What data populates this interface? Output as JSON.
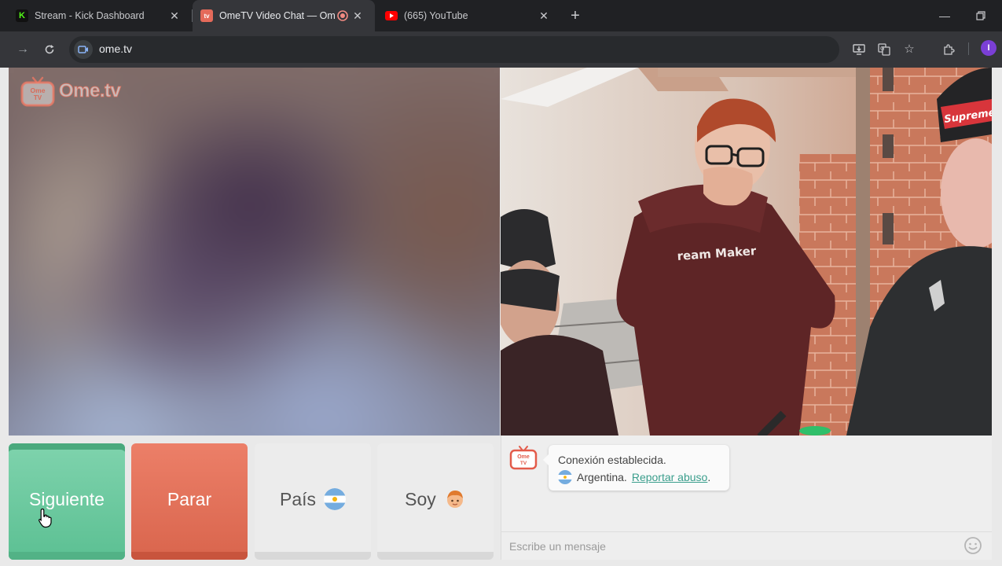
{
  "browser": {
    "tabs": [
      {
        "title": "Stream - Kick Dashboard",
        "favicon": "kick-logo-icon",
        "active": false
      },
      {
        "title": "OmeTV Video Chat — Ome",
        "favicon": "ometv-logo-icon",
        "active": true,
        "recording": true
      },
      {
        "title": "(665) YouTube",
        "favicon": "youtube-logo-icon",
        "active": false
      }
    ],
    "address": "ome.tv",
    "profile_initial": "I"
  },
  "app": {
    "logo_text": "Ome.tv",
    "logo_badge": "Ome TV",
    "buttons": {
      "next": "Siguiente",
      "stop": "Parar",
      "country": "País",
      "gender": "Soy"
    },
    "chat": {
      "status": "Conexión establecida.",
      "country": "Argentina.",
      "report": "Reportar abuso",
      "report_suffix": ".",
      "input_placeholder": "Escribe un mensaje"
    }
  },
  "colors": {
    "next": "#5cc093",
    "stop": "#d9654d",
    "link": "#3a9e8c"
  }
}
